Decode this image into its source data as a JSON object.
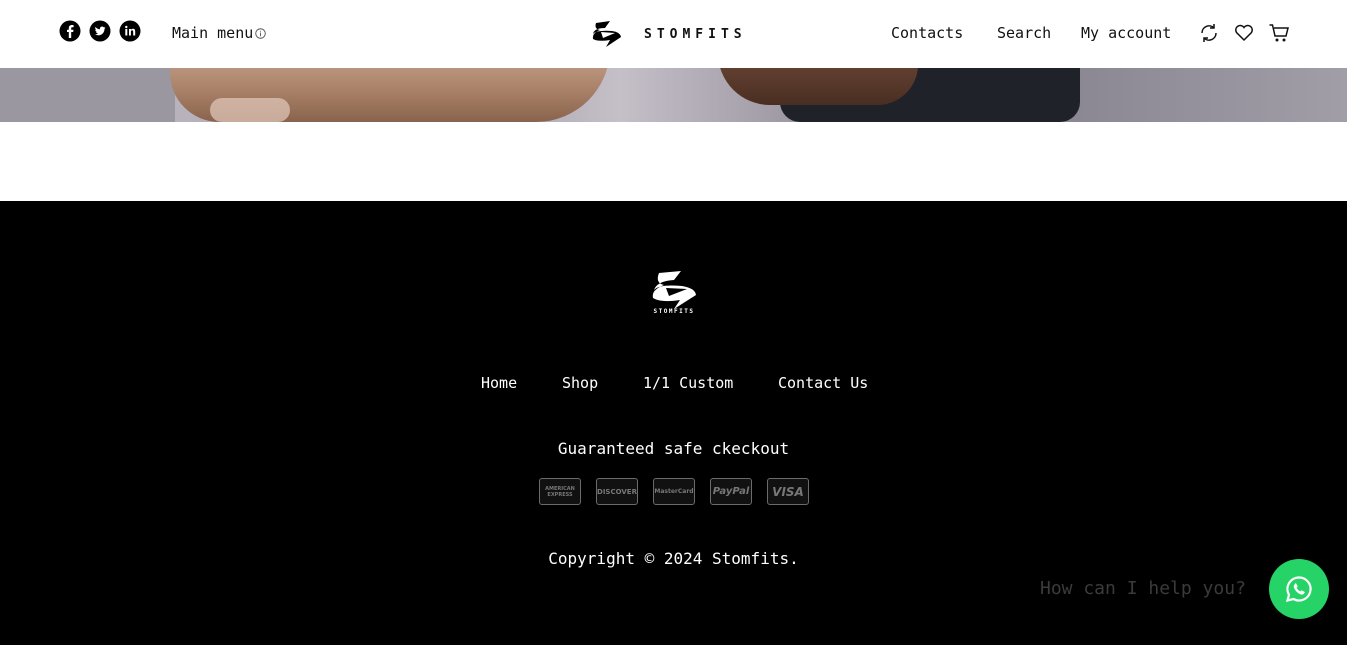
{
  "header": {
    "main_menu_label": "Main menu",
    "brand": "STOMFITS",
    "nav": {
      "contacts": "Contacts",
      "search": "Search",
      "account": "My account"
    },
    "social_icons": [
      "facebook-icon",
      "twitter-icon",
      "linkedin-icon"
    ]
  },
  "footer": {
    "brand": "STOMFITS",
    "nav": {
      "home": "Home",
      "shop": "Shop",
      "custom": "1/1 Custom",
      "contact": "Contact Us"
    },
    "safe_checkout": "Guaranteed safe ckeckout",
    "payment_cards": {
      "amex": "AMERICAN EXPRESS",
      "discover": "DISCOVER",
      "mastercard": "MasterCard",
      "paypal": "PayPal",
      "visa": "VISA"
    },
    "copyright": "Copyright © 2024 Stomfits."
  },
  "chat": {
    "prompt": "How can I help you?",
    "accent": "#25d366"
  }
}
